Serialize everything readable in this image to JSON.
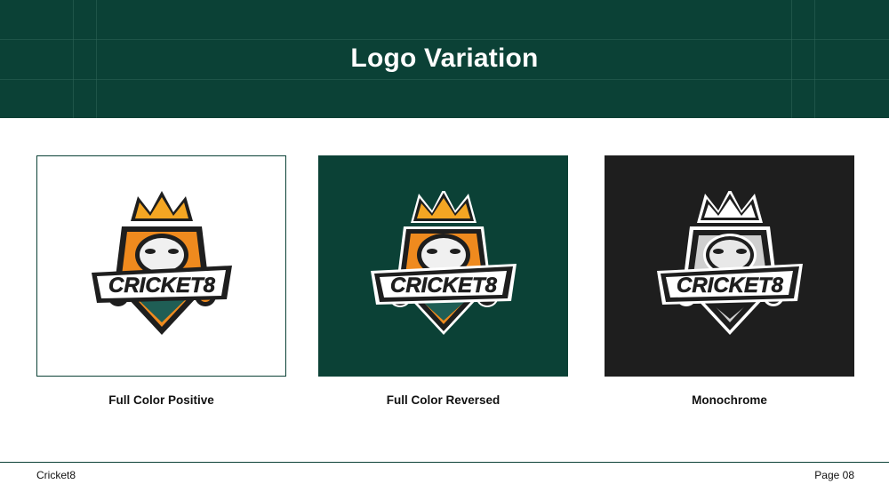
{
  "header": {
    "title": "Logo Variation"
  },
  "variations": [
    {
      "caption": "Full Color Positive",
      "logo_text": "CRICKET8",
      "background": "#ffffff",
      "scheme": "color"
    },
    {
      "caption": "Full Color Reversed",
      "logo_text": "CRICKET8",
      "background": "#0b4136",
      "scheme": "color"
    },
    {
      "caption": "Monochrome",
      "logo_text": "CRICKET8",
      "background": "#1e1e1e",
      "scheme": "mono"
    }
  ],
  "colors": {
    "brand_green": "#0b4136",
    "accent_orange": "#ef8a1e",
    "crown_gold": "#f4a623",
    "dark": "#1e1e1e"
  },
  "footer": {
    "brand": "Cricket8",
    "page": "Page 08"
  }
}
